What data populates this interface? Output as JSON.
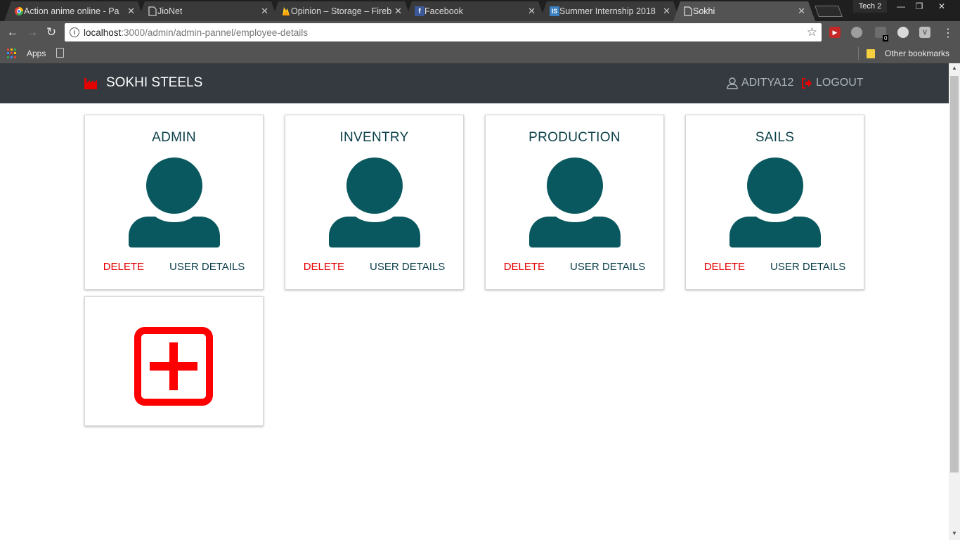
{
  "browser": {
    "tabs": [
      {
        "title": "Action anime online - Pa",
        "favicon": "chrome-colored-icon",
        "active": false
      },
      {
        "title": "JioNet",
        "favicon": "page-icon",
        "active": false
      },
      {
        "title": "Opinion – Storage – Fireb",
        "favicon": "firebase-icon",
        "active": false
      },
      {
        "title": "Facebook",
        "favicon": "facebook-icon",
        "active": false
      },
      {
        "title": "Summer Internship 2018",
        "favicon": "is-icon",
        "active": false
      },
      {
        "title": "Sokhi",
        "favicon": "page-icon",
        "active": true
      }
    ],
    "profile_name": "Tech 2",
    "window_controls": {
      "minimize": "—",
      "restore": "❐",
      "close": "✕"
    },
    "url_host": "localhost",
    "url_path": ":3000/admin/admin-pannel/employee-details",
    "extension_badge": "0",
    "bookmarks": {
      "apps_label": "Apps",
      "other_label": "Other bookmarks"
    }
  },
  "navbar": {
    "brand": "SOKHI STEELS",
    "username": "ADITYA12",
    "logout": "LOGOUT",
    "colors": {
      "background": "#343a40",
      "brand_icon": "#e60000",
      "text_muted": "#adb5bd"
    }
  },
  "cards": [
    {
      "title": "ADMIN",
      "delete_label": "DELETE",
      "details_label": "USER DETAILS"
    },
    {
      "title": "INVENTRY",
      "delete_label": "DELETE",
      "details_label": "USER DETAILS"
    },
    {
      "title": "PRODUCTION",
      "delete_label": "DELETE",
      "details_label": "USER DETAILS"
    },
    {
      "title": "SAILS",
      "delete_label": "DELETE",
      "details_label": "USER DETAILS"
    }
  ],
  "colors": {
    "avatar": "#0a585f",
    "title": "#0b3f48",
    "delete": "#e60000",
    "add": "#ff0000"
  }
}
